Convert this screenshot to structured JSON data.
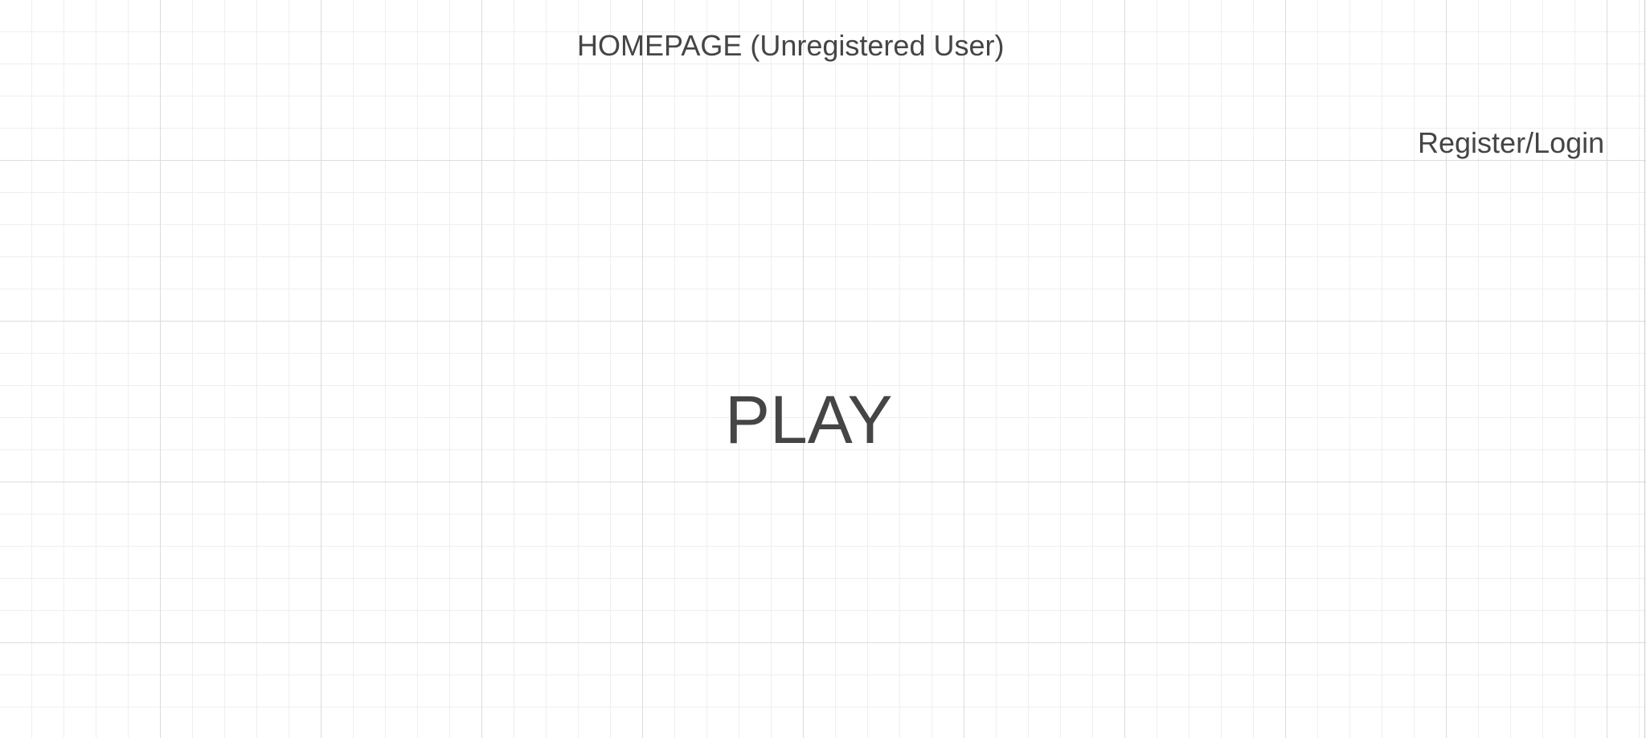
{
  "page": {
    "title": "HOMEPAGE (Unregistered User)"
  },
  "header": {
    "auth_link": "Register/Login"
  },
  "main": {
    "play_label": "PLAY"
  },
  "colors": {
    "text": "#454545",
    "grid_major": "#dcdcdc",
    "grid_minor": "#efefef",
    "background": "#ffffff"
  }
}
